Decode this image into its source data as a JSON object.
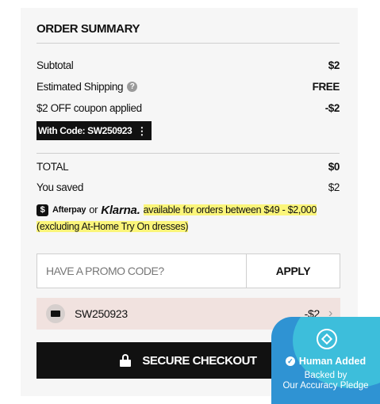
{
  "summary": {
    "title": "ORDER SUMMARY",
    "subtotal_label": "Subtotal",
    "subtotal_value": "$2",
    "shipping_label": "Estimated Shipping",
    "shipping_help": "?",
    "shipping_value": "FREE",
    "coupon_label": "$2 OFF coupon applied",
    "coupon_value": "-$2",
    "code_chip": "With Code: SW250923",
    "code_chip_dots": "⋮",
    "total_label": "TOTAL",
    "total_value": "$0",
    "saved_label": "You saved",
    "saved_value": "$2"
  },
  "bnpl": {
    "afterpay_badge": "$",
    "afterpay_name": "Afterpay",
    "or_word": "or",
    "klarna_name": "Klarna.",
    "text": "available for orders between $49 - $2,000 (excluding At-Home Try On dresses)"
  },
  "promo": {
    "placeholder": "HAVE A PROMO CODE?",
    "value": "",
    "apply_label": "APPLY"
  },
  "applied_coupon": {
    "code": "SW250923",
    "amount": "-$2",
    "chevron": "›"
  },
  "checkout": {
    "label": "SECURE CHECKOUT"
  },
  "trust_badge": {
    "title": "Human Added",
    "check": "✓",
    "line1": "Backed by",
    "line2": "Our Accuracy Pledge"
  },
  "colors": {
    "highlight": "#fbf57a",
    "coupon_bg": "#f1e2df",
    "checkout_bg": "#111111",
    "badge_blue": "#2f93d3",
    "badge_teal": "#3fc6dc"
  }
}
